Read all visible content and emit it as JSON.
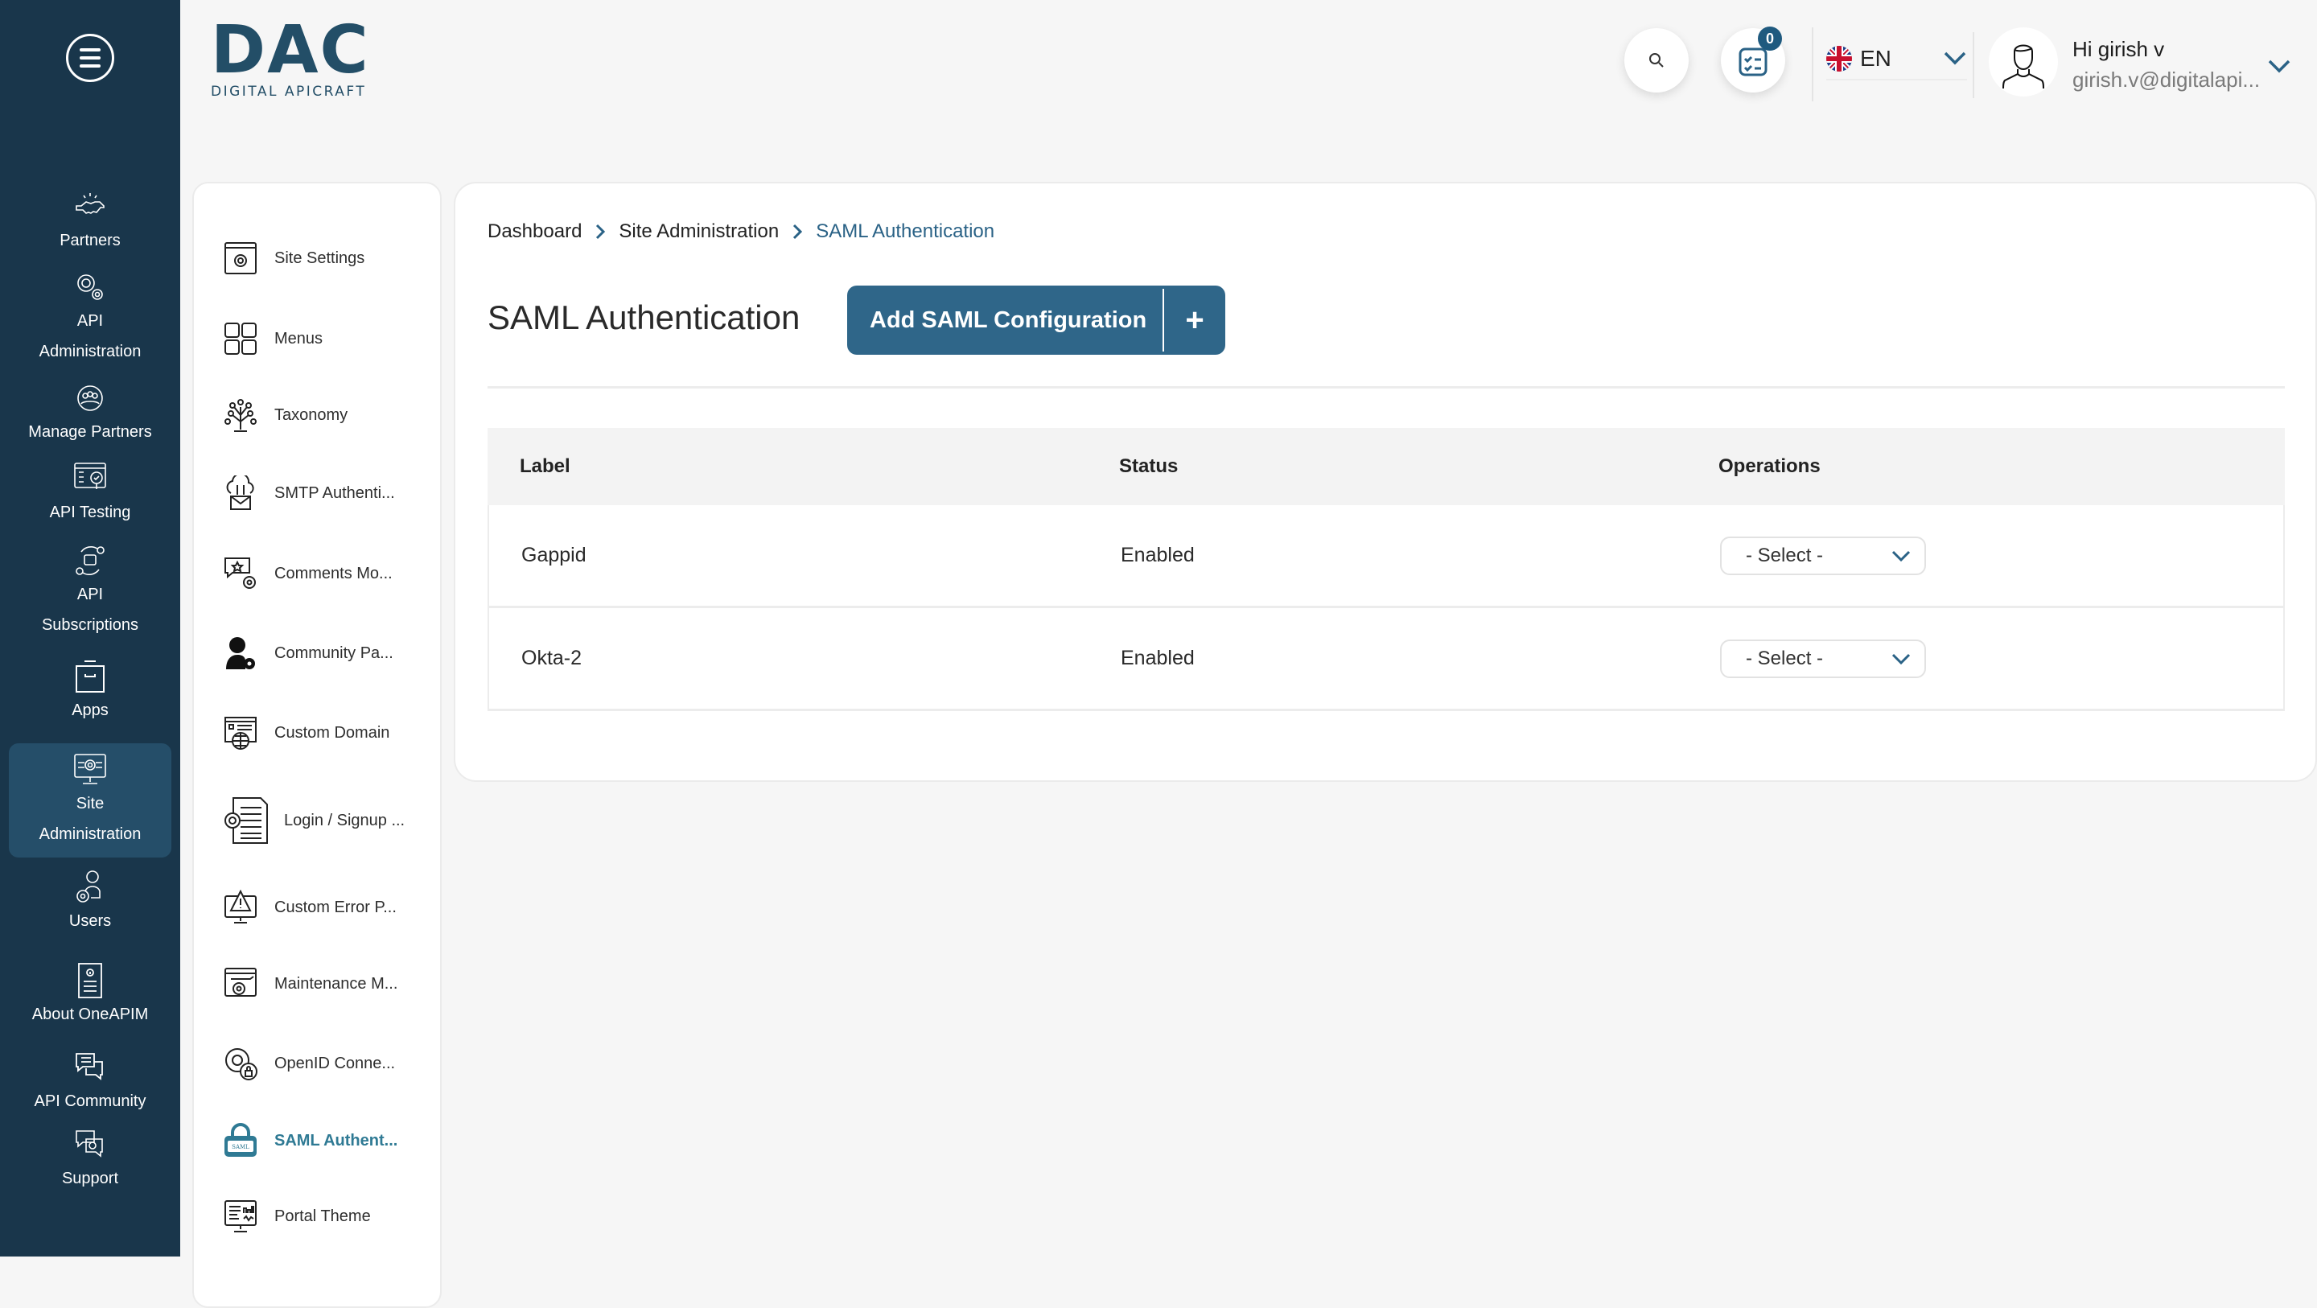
{
  "app": {
    "logo_text": "DAC",
    "logo_subtitle": "DIGITAL APICRAFT",
    "brand_color": "#19364b",
    "accent_color": "#2f6689"
  },
  "leftnav": {
    "menu_icon": "hamburger-menu-icon",
    "items": [
      {
        "label": "Partners",
        "icon": "handshake-icon",
        "active": false
      },
      {
        "label": "API Administration",
        "icon": "gears-icon",
        "active": false
      },
      {
        "label": "Manage Partners",
        "icon": "group-gear-icon",
        "active": false
      },
      {
        "label": "API Testing",
        "icon": "checklist-magnifier-icon",
        "active": false
      },
      {
        "label": "API Subscriptions",
        "icon": "subscription-cycle-icon",
        "active": false
      },
      {
        "label": "Apps",
        "icon": "archive-box-icon",
        "active": false
      },
      {
        "label": "Site Administration",
        "icon": "monitor-gear-icon",
        "active": true
      },
      {
        "label": "Users",
        "icon": "user-gear-icon",
        "active": false
      },
      {
        "label": "About OneAPIM",
        "icon": "info-document-icon",
        "active": false
      },
      {
        "label": "API Community",
        "icon": "chat-bubbles-icon",
        "active": false
      },
      {
        "label": "Support",
        "icon": "support-chat-icon",
        "active": false
      }
    ]
  },
  "header": {
    "search_icon": "search-icon",
    "tasks_badge_count": "0",
    "language": {
      "code": "EN",
      "flag": "uk-flag-icon"
    },
    "user": {
      "greeting": "Hi girish v",
      "email": "girish.v@digitalapi..."
    }
  },
  "submenu": {
    "items": [
      {
        "label": "Site Settings",
        "icon": "browser-gear-icon",
        "active": false
      },
      {
        "label": "Menus",
        "icon": "grid-icon",
        "active": false
      },
      {
        "label": "Taxonomy",
        "icon": "tree-icon",
        "active": false
      },
      {
        "label": "SMTP Authenti...",
        "icon": "cloud-mail-icon",
        "active": false
      },
      {
        "label": "Comments Mo...",
        "icon": "comment-gear-icon",
        "active": false
      },
      {
        "label": "Community Pa...",
        "icon": "person-gear-icon",
        "active": false
      },
      {
        "label": "Custom Domain",
        "icon": "browser-globe-icon",
        "active": false
      },
      {
        "label": "Login / Signup ...",
        "icon": "document-gear-icon",
        "active": false
      },
      {
        "label": "Custom Error P...",
        "icon": "monitor-warning-icon",
        "active": false
      },
      {
        "label": "Maintenance M...",
        "icon": "browser-wrench-icon",
        "active": false
      },
      {
        "label": "OpenID Conne...",
        "icon": "gear-lock-icon",
        "active": false
      },
      {
        "label": "SAML Authent...",
        "icon": "saml-lock-icon",
        "active": true
      },
      {
        "label": "Portal Theme",
        "icon": "monitor-dashboard-icon",
        "active": false
      }
    ]
  },
  "main": {
    "breadcrumb": [
      "Dashboard",
      "Site Administration",
      "SAML Authentication"
    ],
    "title": "SAML Authentication",
    "add_button_label": "Add SAML Configuration",
    "add_button_icon": "+",
    "table": {
      "columns": [
        "Label",
        "Status",
        "Operations"
      ],
      "rows": [
        {
          "label": "Gappid",
          "status": "Enabled",
          "operation": "- Select -"
        },
        {
          "label": "Okta-2",
          "status": "Enabled",
          "operation": "- Select -"
        }
      ]
    }
  }
}
